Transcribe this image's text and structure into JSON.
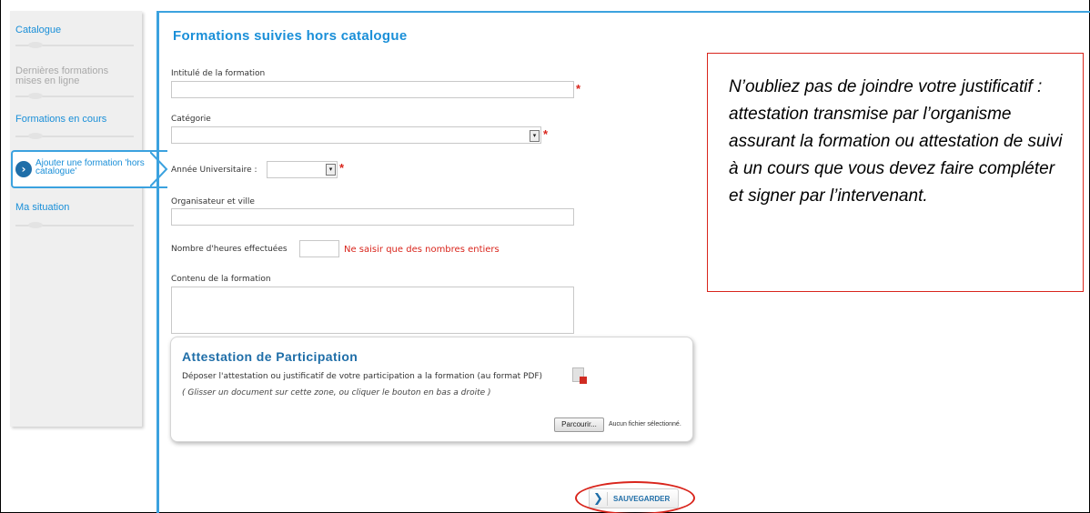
{
  "sidebar": {
    "items": [
      {
        "label": "Catalogue"
      },
      {
        "label": "Dernières formations mises en ligne"
      },
      {
        "label": "Formations en cours"
      },
      {
        "label": "Ajouter une formation 'hors catalogue'"
      },
      {
        "label": "Ma situation"
      }
    ]
  },
  "form": {
    "title": "Formations suivies hors catalogue",
    "intitule_label": "Intitulé de la formation",
    "categorie_label": "Catégorie",
    "annee_label": "Année Universitaire :",
    "organisateur_label": "Organisateur et ville",
    "heures_label": "Nombre d'heures effectuées",
    "heures_note": "Ne saisir que des nombres entiers",
    "contenu_label": "Contenu de la formation",
    "required_mark": "*"
  },
  "attestation": {
    "title": "Attestation de Participation",
    "description": "Déposer l'attestation ou justificatif de votre participation a la formation (au format PDF)",
    "hint": "( Glisser un document sur cette zone, ou cliquer le bouton en bas a droite )",
    "browse_label": "Parcourir...",
    "no_file": "Aucun fichier sélectionné."
  },
  "save": {
    "label": "SAUVEGARDER"
  },
  "callout": {
    "text": "N’oubliez pas de joindre votre justificatif : attestation transmise par l’organisme assurant la formation ou attestation de suivi à un cours que vous devez faire compléter et signer par l’intervenant."
  },
  "colors": {
    "accent": "#1a8fd8",
    "required": "#d9251c",
    "dark_blue": "#1f6ea8"
  }
}
